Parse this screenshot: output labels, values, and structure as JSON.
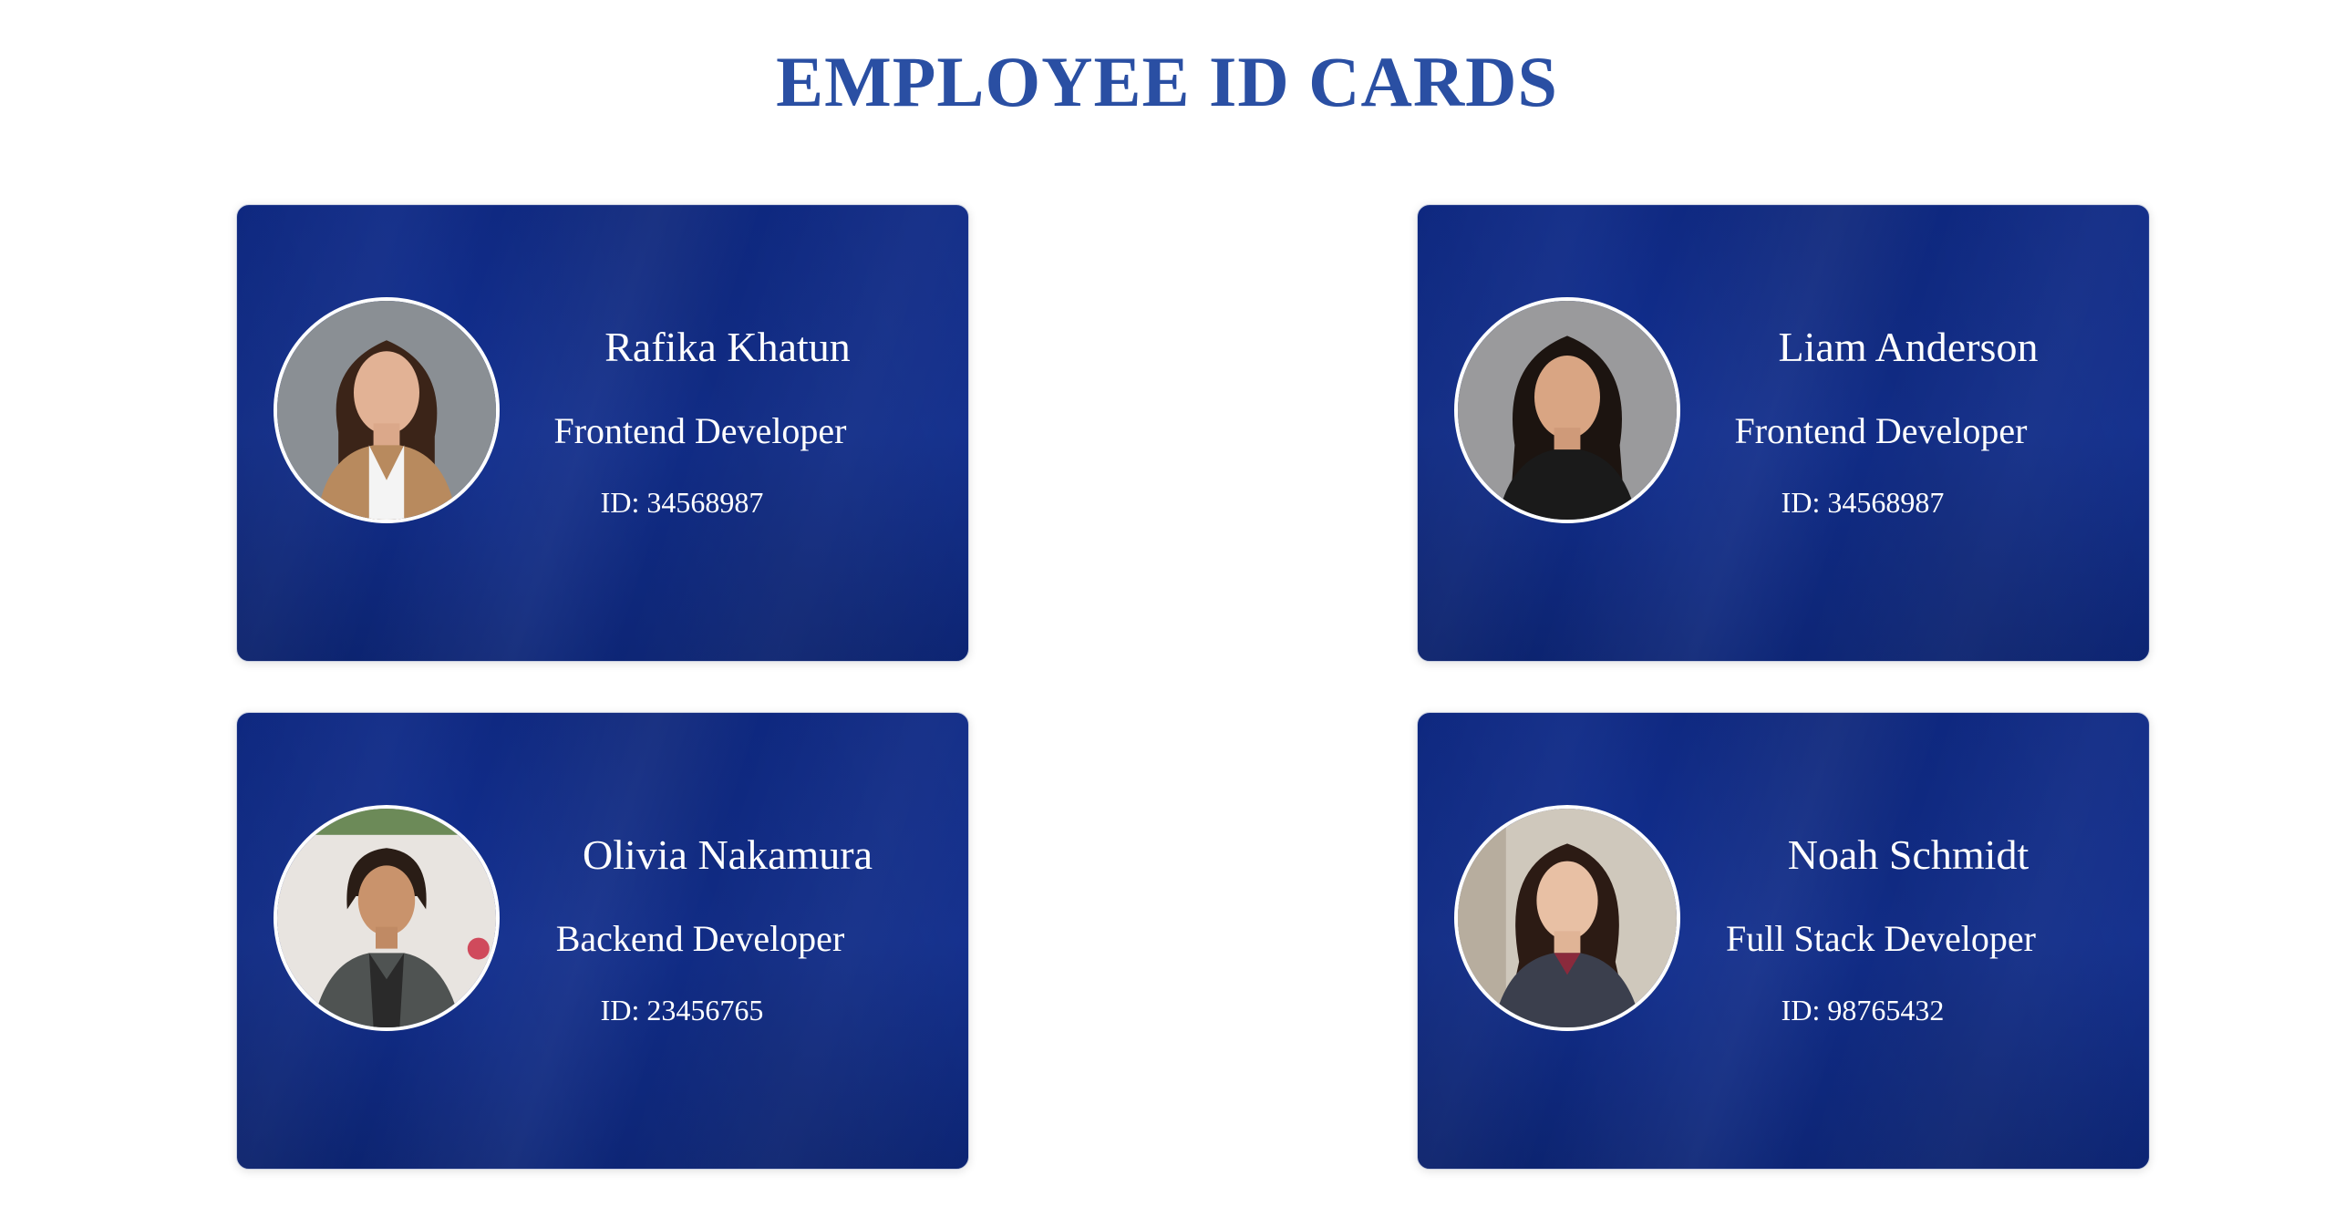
{
  "page": {
    "title": "EMPLOYEE ID CARDS",
    "title_color": "#2a4fa3",
    "card_color": "#122f8f"
  },
  "cards": [
    {
      "name": "Rafika Khatun",
      "role": "Frontend Developer",
      "id_text": "ID: 34568987",
      "photo_icon": "employee-photo-icon"
    },
    {
      "name": "Liam Anderson",
      "role": "Frontend Developer",
      "id_text": "ID: 34568987",
      "photo_icon": "employee-photo-icon"
    },
    {
      "name": "Olivia Nakamura",
      "role": "Backend Developer",
      "id_text": "ID: 23456765",
      "photo_icon": "employee-photo-icon"
    },
    {
      "name": "Noah Schmidt",
      "role": "Full Stack Developer",
      "id_text": "ID: 98765432",
      "photo_icon": "employee-photo-icon"
    }
  ]
}
